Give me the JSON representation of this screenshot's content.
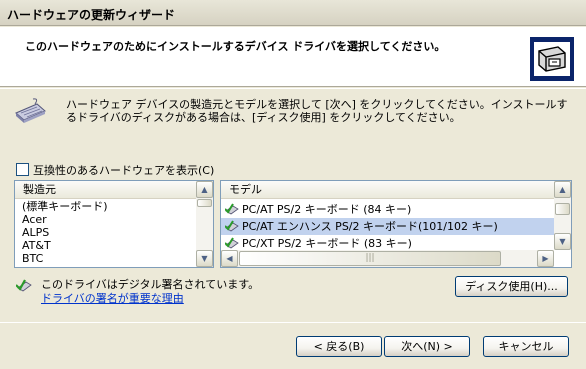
{
  "window": {
    "title": "ハードウェアの更新ウィザード"
  },
  "header": {
    "heading": "このハードウェアのためにインストールするデバイス ドライバを選択してください。",
    "icon": "hardware-install-icon"
  },
  "intro": {
    "icon": "keyboard-icon",
    "text": "ハードウェア デバイスの製造元とモデルを選択して [次へ] をクリックしてください。インストールするドライバのディスクがある場合は、[ディスク使用] をクリックしてください。"
  },
  "compat": {
    "label": "互換性のあるハードウェアを表示(C)",
    "checked": false
  },
  "manufacturer": {
    "header": "製造元",
    "items": [
      "(標準キーボード)",
      "Acer",
      "ALPS",
      "AT&T",
      "BTC"
    ]
  },
  "model": {
    "header": "モデル",
    "items": [
      {
        "label": "PC/AT PS/2 キーボード (84 キー)",
        "selected": false
      },
      {
        "label": "PC/AT エンハンス PS/2 キーボード(101/102 キー)",
        "selected": true
      },
      {
        "label": "PC/XT PS/2 キーボード (83 キー)",
        "selected": false
      }
    ]
  },
  "signature": {
    "text": "このドライバはデジタル署名されています。",
    "link": "ドライバの署名が重要な理由"
  },
  "buttons": {
    "have_disk": "ディスク使用(H)...",
    "back": "< 戻る(B)",
    "next": "次へ(N) >",
    "cancel": "キャンセル"
  }
}
